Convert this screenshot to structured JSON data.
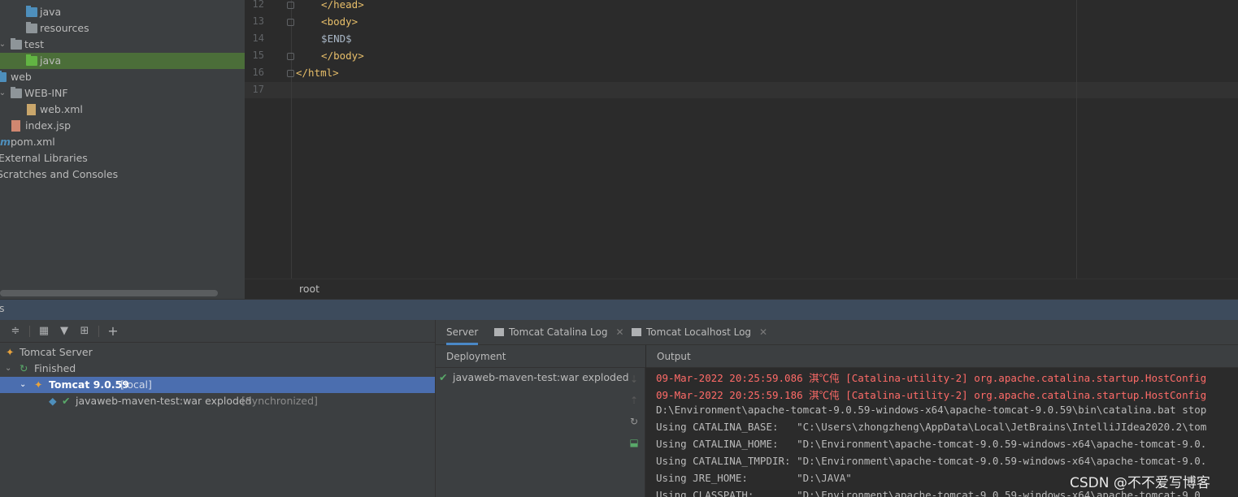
{
  "project_tree": {
    "items": [
      {
        "label": "java",
        "icon": "folder-blue-icon"
      },
      {
        "label": "resources",
        "icon": "folder-resources-icon"
      },
      {
        "label": "test",
        "icon": "folder-grey-icon"
      },
      {
        "label": "java",
        "icon": "folder-green-icon"
      },
      {
        "label": "web",
        "icon": "folder-web-icon"
      },
      {
        "label": "WEB-INF",
        "icon": "folder-grey-icon"
      },
      {
        "label": "web.xml",
        "icon": "xml-file-icon"
      },
      {
        "label": "index.jsp",
        "icon": "jsp-file-icon"
      },
      {
        "label": "pom.xml",
        "icon": "maven-icon"
      },
      {
        "label": "External Libraries",
        "icon": "library-icon"
      },
      {
        "label": "Scratches and Consoles",
        "icon": "scratches-icon"
      }
    ]
  },
  "editor": {
    "lines": [
      {
        "num": "12",
        "code": "  </head>"
      },
      {
        "num": "13",
        "code": "  <body>"
      },
      {
        "num": "14",
        "code": "  $END$"
      },
      {
        "num": "15",
        "code": "  </body>"
      },
      {
        "num": "16",
        "code": "</html>"
      },
      {
        "num": "17",
        "code": ""
      }
    ],
    "breadcrumb": "root"
  },
  "services": {
    "header_label": "s",
    "tree": {
      "root": "Tomcat Server",
      "status": "Finished",
      "server_name": "Tomcat 9.0.59",
      "server_tag": "[local]",
      "artifact": "javaweb-maven-test:war exploded",
      "artifact_tag": "[Synchronized]"
    },
    "tabs": [
      {
        "label": "Server"
      },
      {
        "label": "Tomcat Catalina Log"
      },
      {
        "label": "Tomcat Localhost Log"
      }
    ],
    "deployment_header": "Deployment",
    "deployment_item": "javaweb-maven-test:war exploded",
    "output_header": "Output",
    "output_lines": [
      "09-Mar-2022 20:25:59.086 淇℃伅 [Catalina-utility-2] org.apache.catalina.startup.HostConfig",
      "09-Mar-2022 20:25:59.186 淇℃伅 [Catalina-utility-2] org.apache.catalina.startup.HostConfig",
      "D:\\Environment\\apache-tomcat-9.0.59-windows-x64\\apache-tomcat-9.0.59\\bin\\catalina.bat stop",
      "Using CATALINA_BASE:   \"C:\\Users\\zhongzheng\\AppData\\Local\\JetBrains\\IntelliJIdea2020.2\\tom",
      "Using CATALINA_HOME:   \"D:\\Environment\\apache-tomcat-9.0.59-windows-x64\\apache-tomcat-9.0.",
      "Using CATALINA_TMPDIR: \"D:\\Environment\\apache-tomcat-9.0.59-windows-x64\\apache-tomcat-9.0.",
      "Using JRE_HOME:        \"D:\\JAVA\"",
      "Using CLASSPATH:       \"D:\\Environment\\apache-tomcat-9.0.59-windows-x64\\apache-tomcat-9.0."
    ]
  },
  "watermark": "CSDN @不不爱写博客"
}
